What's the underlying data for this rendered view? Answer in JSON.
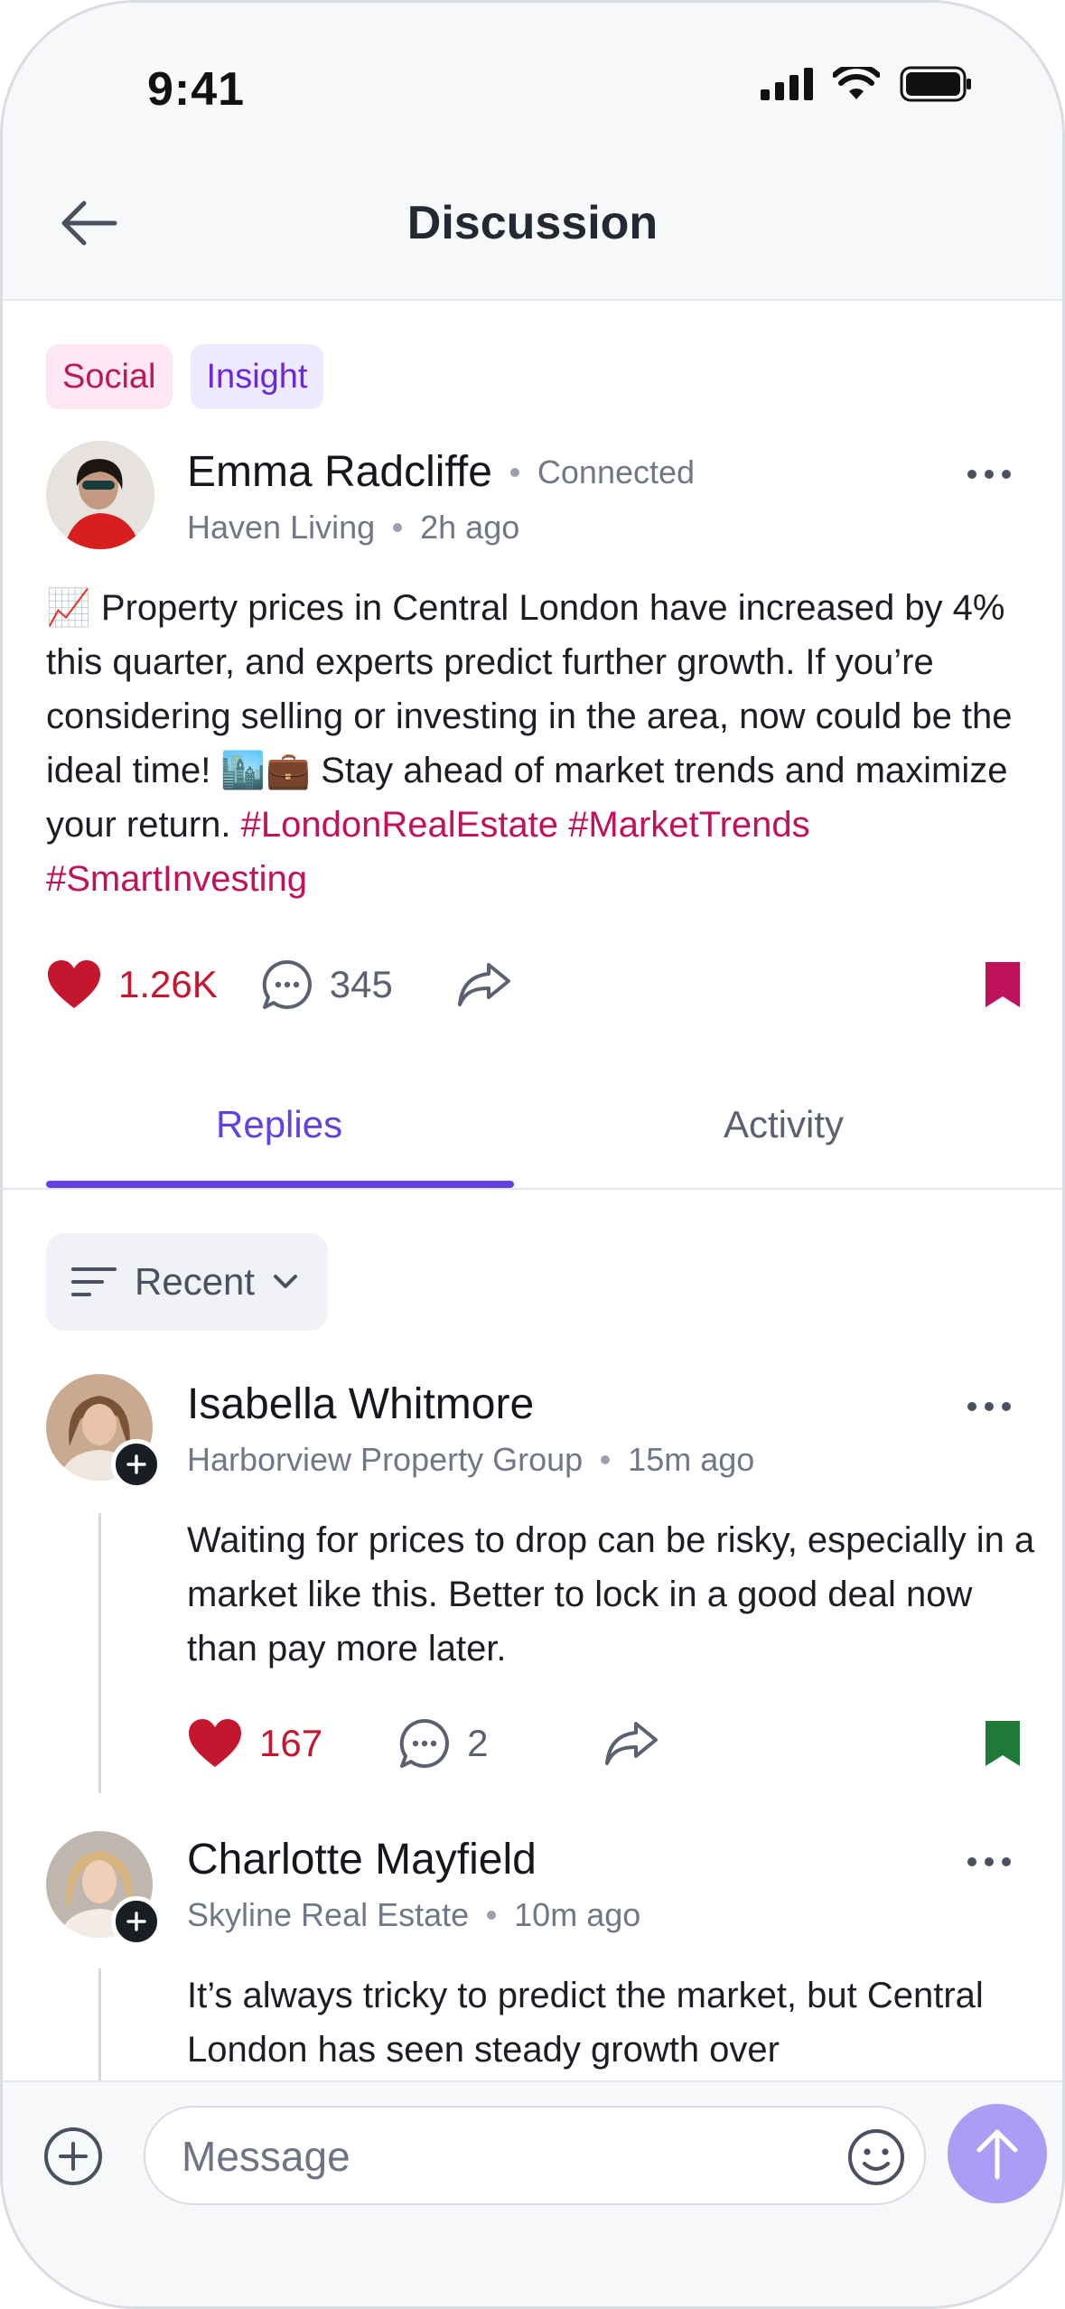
{
  "status_bar": {
    "time": "9:41"
  },
  "nav": {
    "title": "Discussion"
  },
  "post": {
    "tags": [
      "Social",
      "Insight"
    ],
    "author": "Emma Radcliffe",
    "connection": "Connected",
    "company": "Haven Living",
    "time_ago": "2h ago",
    "body": "📈 Property prices in Central London have increased by 4% this quarter, and experts predict further growth. If you’re considering selling or investing in the area, now could be the ideal time! 🏙️💼 Stay ahead of market trends and maximize your return.",
    "hashtags": "#LondonRealEstate #MarketTrends #SmartInvesting",
    "likes": "1.26K",
    "comments": "345",
    "bookmark_color": "#c0125b"
  },
  "tabs": {
    "replies": "Replies",
    "activity": "Activity"
  },
  "sort": {
    "label": "Recent"
  },
  "replies": [
    {
      "author": "Isabella Whitmore",
      "company": "Harborview Property Group",
      "time_ago": "15m ago",
      "body": "Waiting for prices to drop can be risky, especially in a market like this. Better to lock in a good deal now than pay more later.",
      "likes": "167",
      "comments": "2",
      "bookmark_color": "#1f7a3a"
    },
    {
      "author": "Charlotte Mayfield",
      "company": "Skyline Real Estate",
      "time_ago": "10m ago",
      "body": "It’s always tricky to predict the market, but Central London has seen steady growth over"
    }
  ],
  "composer": {
    "placeholder": "Message"
  },
  "colors": {
    "accent": "#6241e0",
    "like": "#c5162f",
    "send": "#a99ef3"
  }
}
